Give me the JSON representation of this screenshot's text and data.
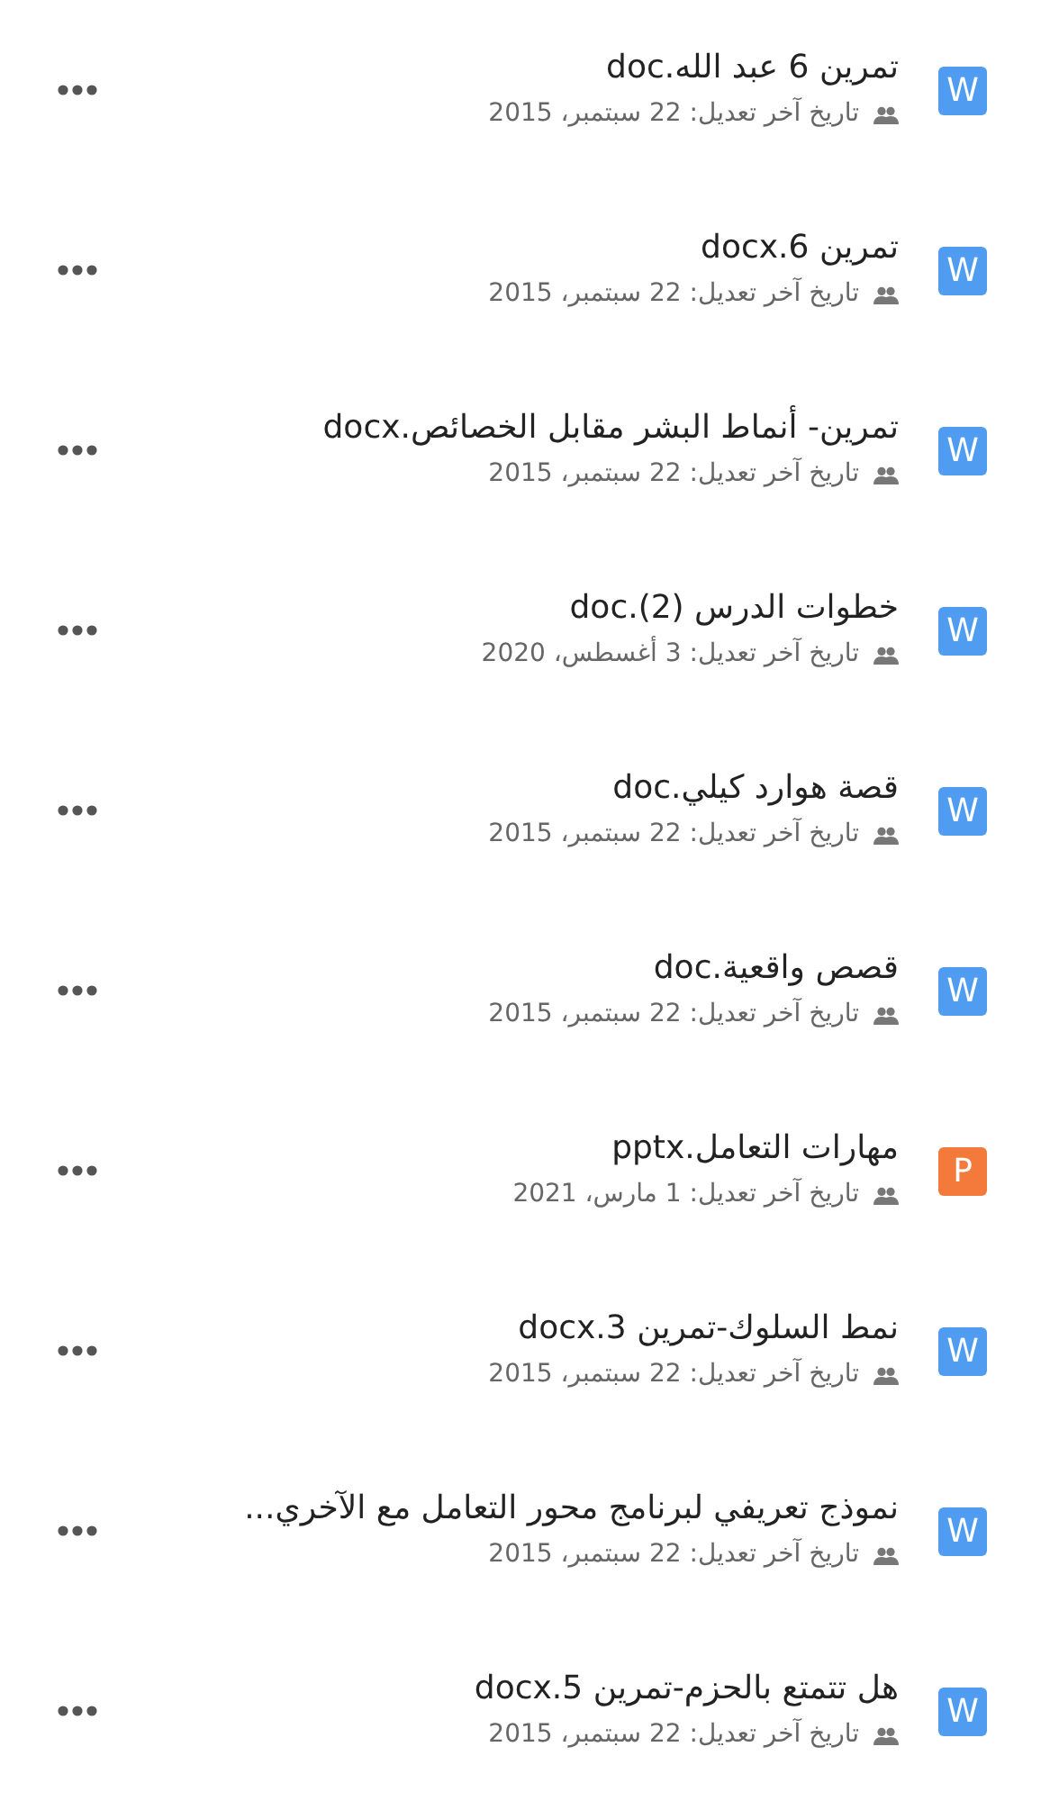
{
  "files": [
    {
      "kind": "word",
      "badge": "W",
      "name": "تمرين 6 عبد الله.doc",
      "meta": "تاريخ آخر تعديل: 22 سبتمبر، 2015"
    },
    {
      "kind": "word",
      "badge": "W",
      "name": "تمرين 6.docx",
      "meta": "تاريخ آخر تعديل: 22 سبتمبر، 2015"
    },
    {
      "kind": "word",
      "badge": "W",
      "name": "تمرين- أنماط البشر مقابل الخصائص.docx",
      "meta": "تاريخ آخر تعديل: 22 سبتمبر، 2015"
    },
    {
      "kind": "word",
      "badge": "W",
      "name": "خطوات الدرس (2).doc",
      "meta": "تاريخ آخر تعديل: 3 أغسطس، 2020"
    },
    {
      "kind": "word",
      "badge": "W",
      "name": "قصة هوارد كيلي.doc",
      "meta": "تاريخ آخر تعديل: 22 سبتمبر، 2015"
    },
    {
      "kind": "word",
      "badge": "W",
      "name": "قصص واقعية.doc",
      "meta": "تاريخ آخر تعديل: 22 سبتمبر، 2015"
    },
    {
      "kind": "powerpoint",
      "badge": "P",
      "name": "مهارات التعامل.pptx",
      "meta": "تاريخ آخر تعديل: 1 مارس، 2021"
    },
    {
      "kind": "word",
      "badge": "W",
      "name": "نمط السلوك-تمرين 3.docx",
      "meta": "تاريخ آخر تعديل: 22 سبتمبر، 2015"
    },
    {
      "kind": "word",
      "badge": "W",
      "name": "نموذج تعريفي لبرنامج محور التعامل مع الآخري...",
      "meta": "تاريخ آخر تعديل: 22 سبتمبر، 2015"
    },
    {
      "kind": "word",
      "badge": "W",
      "name": "هل تتمتع بالحزم-تمرين 5.docx",
      "meta": "تاريخ آخر تعديل: 22 سبتمبر، 2015"
    }
  ]
}
